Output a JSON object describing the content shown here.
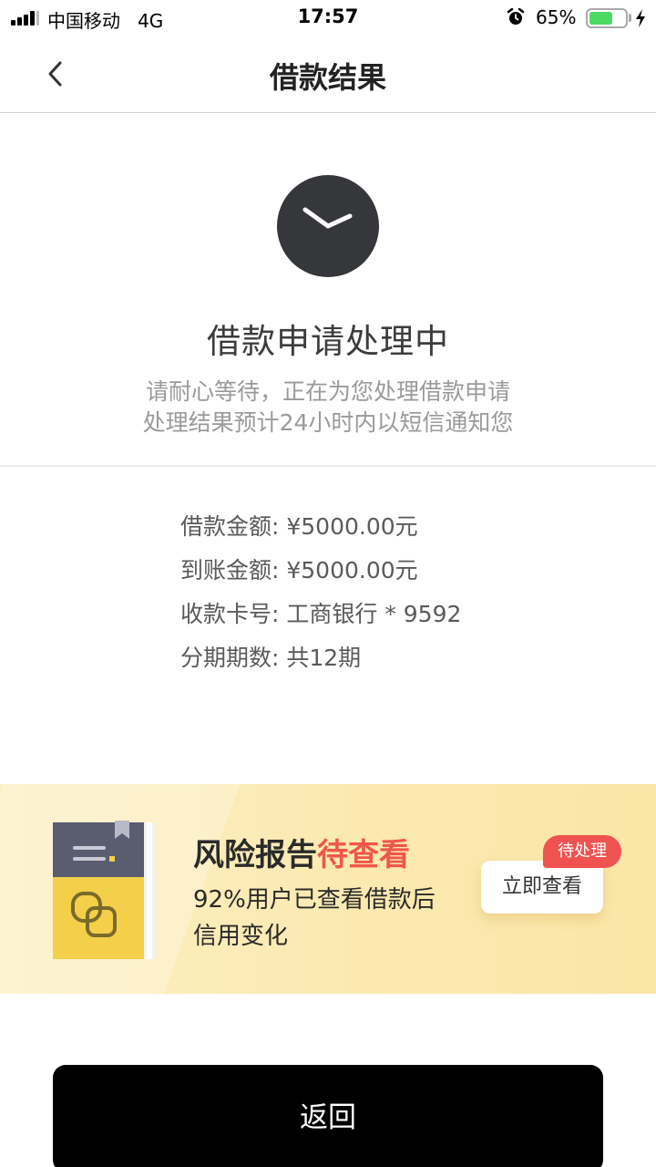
{
  "status_bar": {
    "carrier": "中国移动",
    "network": "4G",
    "time": "17:57",
    "battery_percent": "65%",
    "battery_level": 0.65,
    "icons": [
      "signal-icon",
      "alarm-icon",
      "battery-icon",
      "charging-bolt-icon"
    ]
  },
  "nav": {
    "title": "借款结果",
    "back_icon": "chevron-left-icon"
  },
  "status": {
    "icon": "clock-icon",
    "title": "借款申请处理中",
    "desc_line1": "请耐心等待，正在为您处理借款申请",
    "desc_line2": "处理结果预计24小时内以短信通知您"
  },
  "details": {
    "loan_amount": "借款金额: ¥5000.00元",
    "received_amount": "到账金额: ¥5000.00元",
    "card": "收款卡号: 工商银行 * 9592",
    "installments": "分期期数: 共12期"
  },
  "banner": {
    "icon": "report-book-icon",
    "title_main": "风险报告",
    "title_highlight": "待查看",
    "sub_line1": "92%用户已查看借款后",
    "sub_line2": "信用变化",
    "button_label": "立即查看",
    "badge_label": "待处理",
    "highlight_color": "#f0564a",
    "badge_color": "#ef5350"
  },
  "footer": {
    "return_label": "返回"
  }
}
